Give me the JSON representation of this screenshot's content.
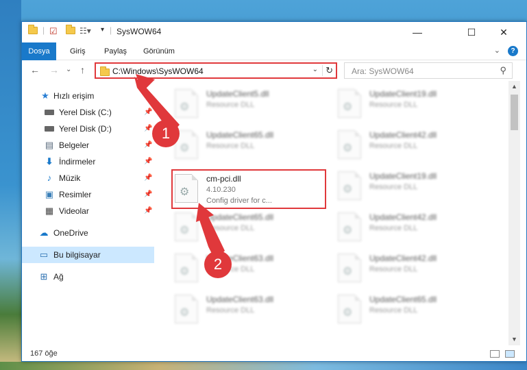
{
  "window": {
    "title": "SysWOW64"
  },
  "ribbon": {
    "tabs": [
      {
        "label": "Dosya",
        "active": true
      },
      {
        "label": "Giriş",
        "active": false
      },
      {
        "label": "Paylaş",
        "active": false
      },
      {
        "label": "Görünüm",
        "active": false
      }
    ],
    "help": "?"
  },
  "nav": {
    "back": "←",
    "forward": "→",
    "recent": "⌄",
    "up": "↑",
    "address": "C:\\Windows\\SysWOW64",
    "search_placeholder": "Ara: SysWOW64"
  },
  "sidebar": {
    "items": [
      {
        "label": "Hızlı erişim",
        "icon": "star-icon"
      },
      {
        "label": "Yerel Disk (C:)",
        "icon": "drive-icon",
        "pinned": true
      },
      {
        "label": "Yerel Disk (D:)",
        "icon": "drive-icon",
        "pinned": true
      },
      {
        "label": "Belgeler",
        "icon": "documents-icon",
        "pinned": true
      },
      {
        "label": "İndirmeler",
        "icon": "download-icon",
        "pinned": true
      },
      {
        "label": "Müzik",
        "icon": "music-icon",
        "pinned": true
      },
      {
        "label": "Resimler",
        "icon": "pictures-icon",
        "pinned": true
      },
      {
        "label": "Videolar",
        "icon": "videos-icon",
        "pinned": true
      },
      {
        "label": "OneDrive",
        "icon": "cloud-icon"
      },
      {
        "label": "Bu bilgisayar",
        "icon": "computer-icon",
        "selected": true
      },
      {
        "label": "Ağ",
        "icon": "network-icon"
      }
    ]
  },
  "files": {
    "left_column": [
      {
        "name": "UpdateClient5.dll",
        "type": "Resource DLL"
      },
      {
        "name": "UpdateClient65.dll",
        "type": "Resource DLL"
      },
      {
        "name": "cm-pci.dll",
        "version": "4.10.230",
        "description": "Config driver for c...",
        "highlighted": true
      },
      {
        "name": "UpdateClient65.dll",
        "type": "Resource DLL"
      },
      {
        "name": "UpdateClient63.dll",
        "type": "Resource DLL"
      },
      {
        "name": "UpdateClient63.dll",
        "type": "Resource DLL"
      }
    ],
    "right_column": [
      {
        "name": "UpdateClient19.dll",
        "type": "Resource DLL"
      },
      {
        "name": "UpdateClient42.dll",
        "type": "Resource DLL"
      },
      {
        "name": "UpdateClient19.dll",
        "type": "Resource DLL"
      },
      {
        "name": "UpdateClient42.dll",
        "type": "Resource DLL"
      },
      {
        "name": "UpdateClient42.dll",
        "type": "Resource DLL"
      },
      {
        "name": "UpdateClient65.dll",
        "type": "Resource DLL"
      }
    ]
  },
  "status": {
    "item_count": "167 öğe"
  },
  "annotations": {
    "step1": "1",
    "step2": "2",
    "color": "#e0383b"
  }
}
